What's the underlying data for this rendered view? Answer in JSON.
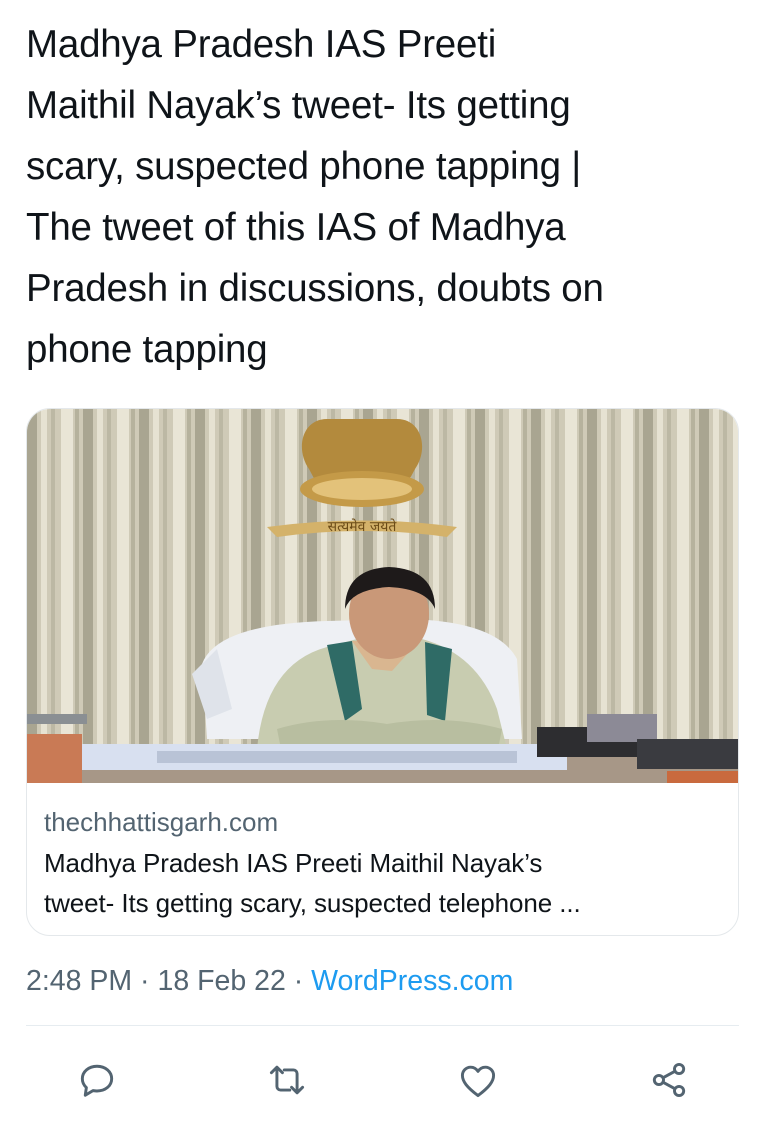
{
  "tweet": {
    "text_lines": [
      "Madhya Pradesh IAS Preeti",
      "Maithil Nayak’s tweet- Its getting",
      "scary, suspected phone tapping |",
      "The tweet of this IAS of Madhya",
      "Pradesh in discussions, doubts on",
      "phone tapping"
    ]
  },
  "card": {
    "image_text": "सत्यमेव जयते",
    "domain": "thechhattisgarh.com",
    "title_lines": [
      "Madhya Pradesh IAS Preeti Maithil Nayak’s",
      "tweet- Its getting scary, suspected telephone ..."
    ]
  },
  "meta": {
    "time": "2:48 PM",
    "separator": " · ",
    "date": "18 Feb 22",
    "source": "WordPress.com"
  },
  "actions": [
    {
      "name": "reply",
      "icon": "reply-icon"
    },
    {
      "name": "retweet",
      "icon": "retweet-icon"
    },
    {
      "name": "like",
      "icon": "heart-icon"
    },
    {
      "name": "share",
      "icon": "share-icon"
    }
  ],
  "colors": {
    "text": "#0f1419",
    "secondary": "#536471",
    "link": "#1d9bf0"
  }
}
